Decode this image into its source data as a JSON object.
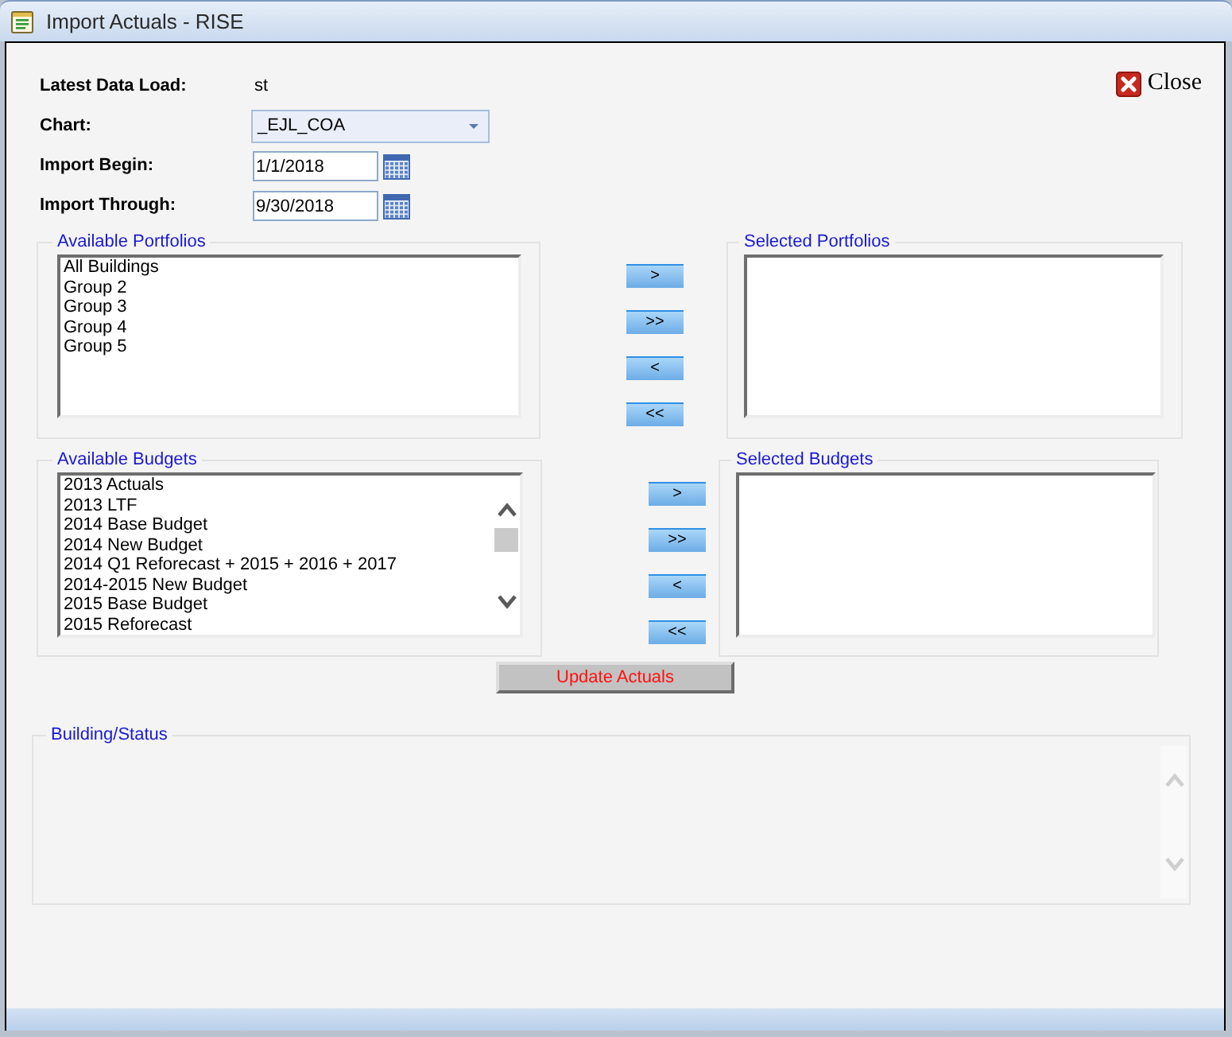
{
  "window": {
    "title": "Import Actuals - RISE"
  },
  "close_button": {
    "label": "Close"
  },
  "form_rows": [
    {
      "kind": "text",
      "label": "Latest Data Load:",
      "value": "st"
    },
    {
      "kind": "select",
      "label": "Chart:",
      "value": "_EJL_COA"
    },
    {
      "kind": "date",
      "label": "Import Begin:",
      "value": "1/1/2018"
    },
    {
      "kind": "date",
      "label": "Import Through:",
      "value": "9/30/2018"
    }
  ],
  "portfolios": {
    "available": {
      "legend": "Available Portfolios",
      "items": [
        "All Buildings",
        "Group 2",
        "Group 3",
        "Group 4",
        "Group 5"
      ]
    },
    "move_buttons": [
      ">",
      ">>",
      "<",
      "<<"
    ],
    "selected": {
      "legend": "Selected Portfolios"
    }
  },
  "budgets": {
    "available": {
      "legend": "Available Budgets",
      "items": [
        "2013 Actuals",
        "2013 LTF",
        "2014 Base Budget",
        "2014 New Budget",
        "2014 Q1 Reforecast + 2015 + 2016 + 2017",
        "2014-2015 New Budget",
        "2015 Base Budget",
        "2015 Reforecast"
      ]
    },
    "move_buttons": [
      ">",
      ">>",
      "<",
      "<<"
    ],
    "selected": {
      "legend": "Selected Budgets"
    }
  },
  "update_button": {
    "label": "Update Actuals"
  },
  "building_status": {
    "legend": "Building/Status"
  }
}
